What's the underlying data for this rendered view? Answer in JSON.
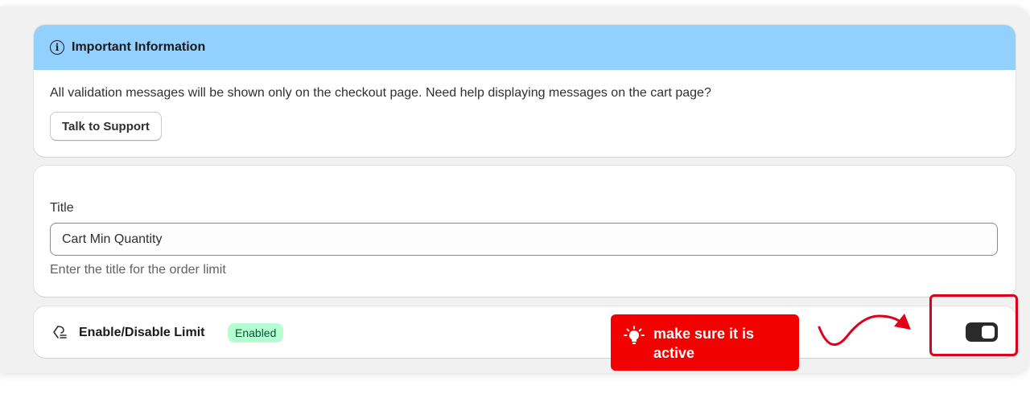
{
  "info_card": {
    "title": "Important Information",
    "icon": "info-circle-icon",
    "message": "All validation messages will be shown only on the checkout page. Need help displaying messages on the cart page?",
    "support_button": "Talk to Support"
  },
  "title_card": {
    "label": "Title",
    "value": "Cart Min Quantity",
    "help_text": "Enter the title for the order limit"
  },
  "limit_card": {
    "icon": "tag-limit-icon",
    "label": "Enable/Disable Limit",
    "badge": "Enabled",
    "toggle_on": true
  },
  "annotation": {
    "callout_text": "make sure it is active",
    "icon": "lightbulb-icon",
    "color": "#f30000",
    "box_color": "#e0001b"
  },
  "colors": {
    "banner": "#91d0ff",
    "badge_bg": "#b4fed2",
    "badge_text": "#0c5132",
    "toggle": "#2a2a2a"
  }
}
